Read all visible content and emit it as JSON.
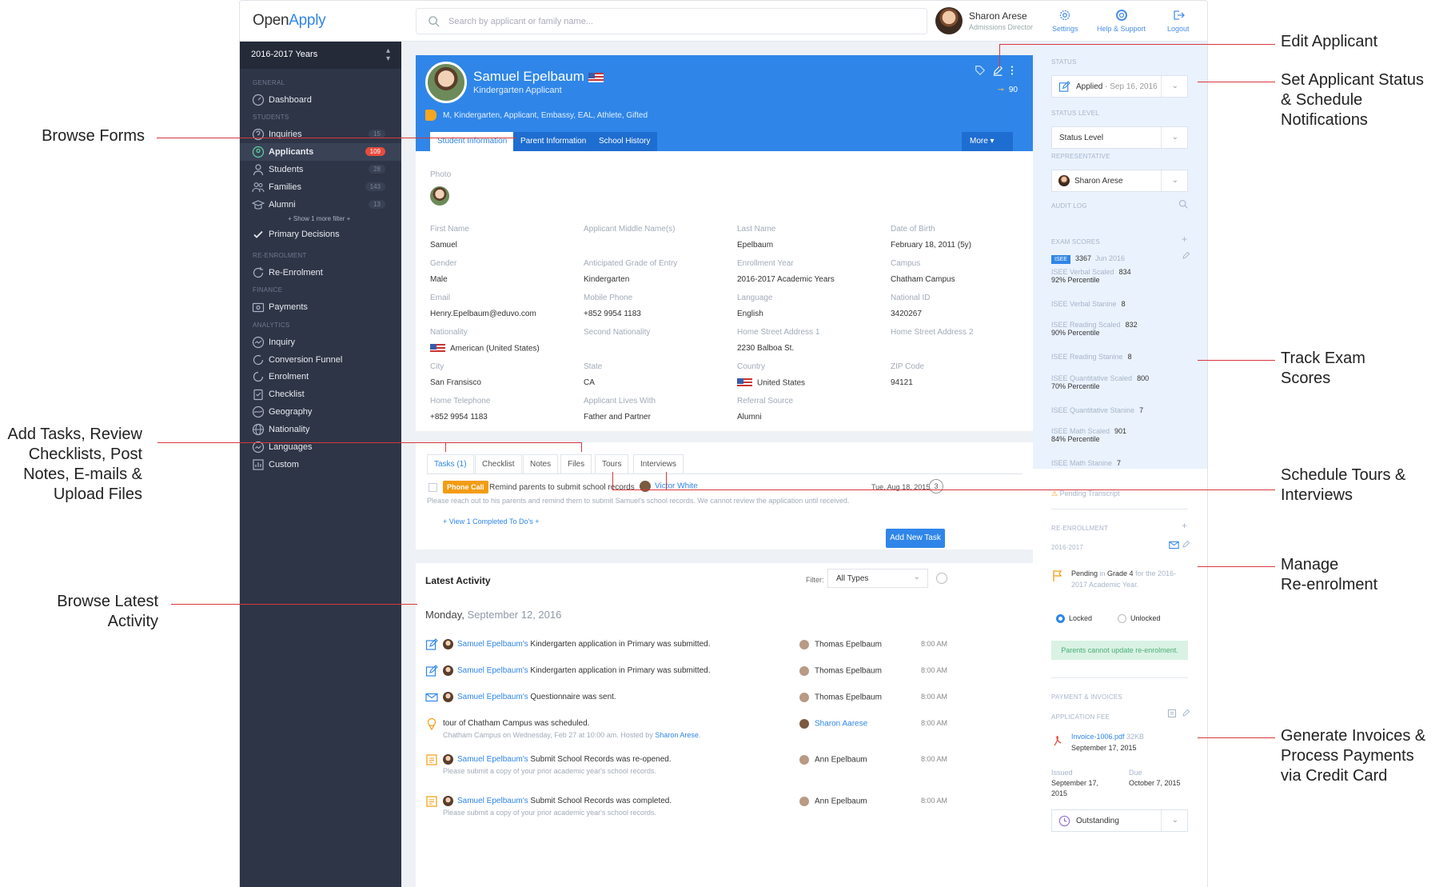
{
  "app": {
    "logo_a": "Open",
    "logo_b": "Apply",
    "search_placeholder": "Search by applicant or family name...",
    "user_name": "Sharon Arese",
    "user_role": "Admissions Director",
    "toolbar": {
      "settings": "Settings",
      "help": "Help & Support",
      "logout": "Logout"
    }
  },
  "sidebar": {
    "year": "2016-2017 Years",
    "sections": {
      "general": "GENERAL",
      "students": "STUDENTS",
      "reenrol": "RE-ENROLMENT",
      "finance": "FINANCE",
      "analytics": "ANALYTICS"
    },
    "dashboard": "Dashboard",
    "inquiries": {
      "label": "Inquiries",
      "count": "15"
    },
    "applicants": {
      "label": "Applicants",
      "count": "109"
    },
    "students": {
      "label": "Students",
      "count": "28"
    },
    "families": {
      "label": "Families",
      "count": "143"
    },
    "alumni": {
      "label": "Alumni",
      "count": "13"
    },
    "show_more": "+ Show 1 more filter +",
    "primary": "Primary Decisions",
    "reenrolment": "Re-Enrolment",
    "payments": "Payments",
    "analytics_items": [
      "Inquiry",
      "Conversion Funnel",
      "Enrolment",
      "Checklist",
      "Geography",
      "Nationality",
      "Languages",
      "Custom"
    ]
  },
  "profile": {
    "name": "Samuel Epelbaum",
    "subtitle": "Kindergarten Applicant",
    "tags": "M,  Kindergarten,  Applicant,   Embassy,   EAL,   Athlete,   Gifted",
    "score": "90",
    "tabs": [
      "Student Information",
      "Parent Information",
      "School History"
    ],
    "more": "More ▾",
    "photo_label": "Photo",
    "fields": [
      {
        "label": "First Name",
        "value": "Samuel"
      },
      {
        "label": "Applicant Middle Name(s)",
        "value": ""
      },
      {
        "label": "Last Name",
        "value": "Epelbaum"
      },
      {
        "label": "Date of Birth",
        "value": "February 18, 2011 (5y)"
      },
      {
        "label": "Gender",
        "value": "Male"
      },
      {
        "label": "Anticipated Grade of Entry",
        "value": "Kindergarten"
      },
      {
        "label": "Enrollment Year",
        "value": "2016-2017 Academic Years"
      },
      {
        "label": "Campus",
        "value": "Chatham Campus"
      },
      {
        "label": "Email",
        "value": "Henry.Epelbaum@eduvo.com"
      },
      {
        "label": "Mobile Phone",
        "value": "+852 9954 1183"
      },
      {
        "label": "Language",
        "value": "English"
      },
      {
        "label": "National ID",
        "value": "3420267"
      },
      {
        "label": "Nationality",
        "value": "American (United States)"
      },
      {
        "label": "Second Nationality",
        "value": ""
      },
      {
        "label": "Home Street Address 1",
        "value": "2230 Balboa St."
      },
      {
        "label": "Home Street Address 2",
        "value": ""
      },
      {
        "label": "City",
        "value": "San Fransisco"
      },
      {
        "label": "State",
        "value": "CA"
      },
      {
        "label": "Country",
        "value": "United States"
      },
      {
        "label": "ZIP Code",
        "value": "94121"
      },
      {
        "label": "Home Telephone",
        "value": "+852 9954 1183"
      },
      {
        "label": "Applicant Lives With",
        "value": "Father and Partner"
      },
      {
        "label": "Referral Source",
        "value": "Alumni"
      }
    ]
  },
  "tasks": {
    "tabs": [
      "Tasks (1)",
      "Checklist",
      "Notes",
      "Files",
      "Tours",
      "Interviews"
    ],
    "badge": "Phone Call",
    "text": "Remind parents to submit school records",
    "arrow": "→",
    "person": "Victor White",
    "date": "Tue, Aug 18, 2015",
    "count": "3",
    "desc": "Please reach out to his parents and remind them to submit Samuel's school records. We cannot review the application until received.",
    "view_completed": "+ View 1 Completed To Do's +",
    "add": "Add New Task"
  },
  "activity": {
    "title": "Latest Activity",
    "filter_label": "Filter:",
    "filter_value": "All Types",
    "day": "Monday,",
    "date": "September 12, 2016",
    "rows": [
      {
        "link": "Samuel Epelbaum's",
        "text": " Kindergarten application in Primary was submitted.",
        "who": "Thomas Epelbaum",
        "time": "8:00 AM"
      },
      {
        "link": "Samuel Epelbaum's",
        "text": " Kindergarten application in Primary was submitted.",
        "who": "Thomas Epelbaum",
        "time": "8:00 AM"
      },
      {
        "link": "Samuel Epelbaum's",
        "text": " Questionnaire was sent.",
        "who": "Thomas Epelbaum",
        "time": "8:00 AM"
      },
      {
        "text": "tour of Chatham Campus was scheduled.",
        "sub_a": "Chatham Campus on Wednesday, Feb 27 at 10:00 am. Hosted by ",
        "sub_link": "Sharon Arese",
        "sub_b": ".",
        "who": "Sharon Aarese",
        "time": "8:00 AM"
      },
      {
        "link": "Samuel Epelbaum's",
        "text": " Submit School Records was re-opened.",
        "sub": "Please submit a copy of your prior academic year's school records.",
        "who": "Ann Epelbaum",
        "time": "8:00 AM"
      },
      {
        "link": "Samuel Epelbaum's",
        "text": " Submit School Records was completed.",
        "sub": "Please submit a copy of your prior academic year's school records.",
        "who": "Ann Epelbaum",
        "time": "8:00 AM"
      }
    ]
  },
  "right": {
    "status_label": "STATUS",
    "status": "Applied",
    "status_date": " - Sep 16, 2016",
    "level_label": "STATUS LEVEL",
    "level": "Status Level",
    "rep_label": "REPRESENTATIVE",
    "rep": "Sharon Arese",
    "audit": "AUDIT LOG",
    "exam_label": "EXAM SCORES",
    "isee": "ISEE",
    "isee_score": "3367",
    "isee_date": "Jun 2016",
    "exams": [
      {
        "label": "ISEE Verbal Scaled",
        "value": "834",
        "pct": "92% Percentile"
      },
      {
        "label": "ISEE Verbal Stanine",
        "value": "8"
      },
      {
        "label": "ISEE Reading Scaled",
        "value": "832",
        "pct": "90% Percentile"
      },
      {
        "label": "ISEE Reading Stanine",
        "value": "8"
      },
      {
        "label": "ISEE Quantitative Scaled",
        "value": "800",
        "pct": "70% Percentile"
      },
      {
        "label": "ISEE Quantitative Stanine",
        "value": "7"
      },
      {
        "label": "ISEE Math Scaled",
        "value": "901",
        "pct": "84% Percentile"
      },
      {
        "label": "ISEE Math Stanine",
        "value": "7"
      }
    ],
    "pending_transcript": "Pending Transcript",
    "reenrol_label": "RE-ENROLLMENT",
    "reenrol_year": "2016-2017",
    "reenrol_a": "Pending",
    "reenrol_b": " in ",
    "reenrol_c": "Grade 4",
    "reenrol_d": " for the 2016-2017 Academic Year.",
    "locked": "Locked",
    "unlocked": "Unlocked",
    "notice": "Parents cannot update re-enrolment.",
    "pay_label": "PAYMENT & INVOICES",
    "fee_label": "APPLICATION FEE",
    "invoice": "Invoice-1006.pdf",
    "invoice_size": " 32KB",
    "invoice_date": "September 17, 2015",
    "issued_label": "Issued",
    "issued": "September 17, 2015",
    "due_label": "Due",
    "due": "October 7, 2015",
    "outstanding": "Outstanding"
  },
  "annotations": {
    "edit": "Edit Applicant",
    "status": [
      "Set Applicant Status",
      "& Schedule",
      "Notifications"
    ],
    "forms": "Browse Forms",
    "tasks": [
      "Add Tasks, Review",
      "Checklists, Post",
      "Notes, E-mails &",
      "Upload Files"
    ],
    "exam": [
      "Track Exam",
      "Scores"
    ],
    "tours": [
      "Schedule Tours &",
      "Interviews"
    ],
    "reenrol": [
      "Manage",
      "Re-enrolment"
    ],
    "latest": [
      "Browse Latest",
      "Activity"
    ],
    "invoices": [
      "Generate Invoices &",
      "Process Payments",
      "via Credit Card"
    ]
  }
}
